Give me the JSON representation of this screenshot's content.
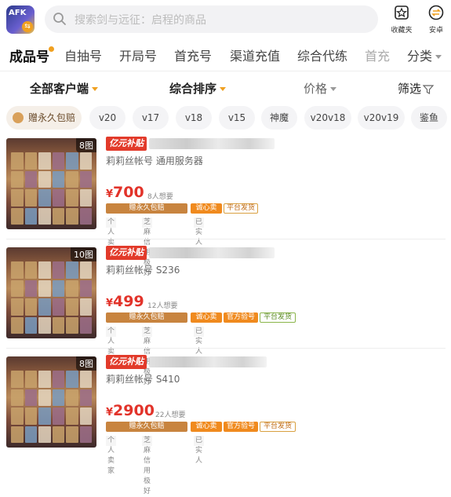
{
  "top": {
    "search_placeholder": "搜索剑与远征：启程的商品",
    "favorites_label": "收藏夹",
    "platform_label": "安卓"
  },
  "categories": [
    "成品号",
    "自抽号",
    "开局号",
    "首充号",
    "渠道充值",
    "综合代练",
    "首充"
  ],
  "categories_more": "分类",
  "filters": {
    "client": "全部客户端",
    "sort": "综合排序",
    "price": "价格",
    "filter": "筛选"
  },
  "tags": [
    "赠永久包赔",
    "v20",
    "v17",
    "v18",
    "v15",
    "神魔",
    "v20v18",
    "v20v19",
    "鉴鱼"
  ],
  "listings": [
    {
      "image_count": "8图",
      "subsidy": "亿元补贴",
      "title": "莉莉丝帐号 通用服务器",
      "currency": "¥",
      "price": "700",
      "want": "8人想要",
      "badges": [
        "赠永久包赔",
        "诚心卖",
        "平台发货"
      ],
      "seller_tags": [
        "个人卖家",
        "芝麻信用极好",
        "已实人"
      ]
    },
    {
      "image_count": "10图",
      "subsidy": "亿元补贴",
      "title": "莉莉丝帐号 S236",
      "currency": "¥",
      "price": "499",
      "want": "12人想要",
      "badges": [
        "赠永久包赔",
        "诚心卖",
        "官方验号",
        "平台发货"
      ],
      "seller_tags": [
        "个人卖家",
        "芝麻信用极好",
        "已实人"
      ]
    },
    {
      "image_count": "8图",
      "subsidy": "亿元补贴",
      "title": "莉莉丝帐号 S410",
      "currency": "¥",
      "price": "2900",
      "want": "22人想要",
      "badges": [
        "赠永久包赔",
        "诚心卖",
        "官方验号",
        "平台发货"
      ],
      "seller_tags": [
        "个人卖家",
        "芝麻信用极好",
        "已实人"
      ]
    }
  ],
  "colors": {
    "accent": "#f0a020",
    "price": "#e2332a",
    "subsidy": "#e23a2a"
  }
}
